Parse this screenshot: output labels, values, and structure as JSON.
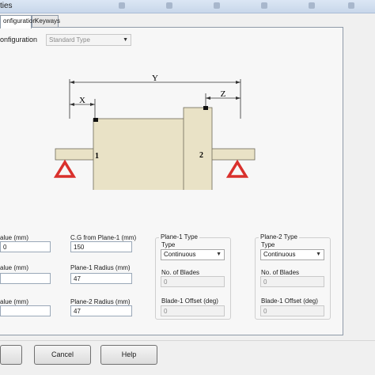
{
  "window": {
    "title": "ties"
  },
  "tabs": [
    {
      "label": "onfiguration",
      "active": true
    },
    {
      "label": "Keyways",
      "active": false
    }
  ],
  "configuration": {
    "label": "onfiguration",
    "value": "Standard Type"
  },
  "diagram": {
    "dim_y": "Y",
    "dim_x": "X",
    "dim_z": "Z",
    "plane1": "1",
    "plane2": "2",
    "colors": {
      "rotor": "#e9e2c6",
      "support": "#d9302c"
    }
  },
  "left_fields": [
    {
      "label": "alue (mm)",
      "value": "0"
    },
    {
      "label": "alue (mm)",
      "value": ""
    },
    {
      "label": "alue (mm)",
      "value": ""
    }
  ],
  "cg": {
    "label": "C.G from Plane-1 (mm)",
    "value": "150"
  },
  "plane1_radius": {
    "label": "Plane-1 Radius (mm)",
    "value": "47"
  },
  "plane2_radius": {
    "label": "Plane-2 Radius (mm)",
    "value": "47"
  },
  "plane1": {
    "title": "Plane-1 Type",
    "type_label": "Type",
    "type_value": "Continuous",
    "blades_label": "No. of Blades",
    "blades_value": "0",
    "offset_label": "Blade-1 Offset (deg)",
    "offset_value": "0"
  },
  "plane2": {
    "title": "Plane-2 Type",
    "type_label": "Type",
    "type_value": "Continuous",
    "blades_label": "No. of Blades",
    "blades_value": "0",
    "offset_label": "Blade-1 Offset (deg)",
    "offset_value": "0"
  },
  "buttons": {
    "cancel": "Cancel",
    "help": "Help"
  }
}
